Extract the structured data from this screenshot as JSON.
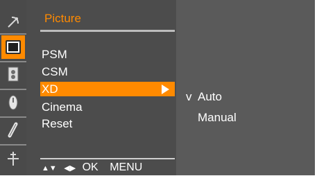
{
  "osd": {
    "title": "Picture",
    "sidebar_icons": [
      {
        "name": "satellite-dish-icon"
      },
      {
        "name": "picture-icon",
        "selected": true
      },
      {
        "name": "speaker-icon"
      },
      {
        "name": "time-clock-icon"
      },
      {
        "name": "option-tool-icon"
      },
      {
        "name": "screen-setup-icon"
      }
    ],
    "menu": {
      "items": [
        "PSM",
        "CSM",
        "XD",
        "Cinema",
        "Reset"
      ],
      "selected": "XD"
    },
    "submenu": {
      "check_mark": "v",
      "items": [
        "Auto",
        "Manual"
      ],
      "checked": "Auto"
    },
    "nav_hint": {
      "updown_glyph": "▲▼",
      "leftright_glyph": "◀▶",
      "ok_label": "OK",
      "menu_label": "MENU"
    },
    "colors": {
      "accent": "#ff8a00",
      "panel_bg": "#4c4c4c",
      "subpanel_bg": "#5a5a5a",
      "text": "#ffffff"
    }
  }
}
